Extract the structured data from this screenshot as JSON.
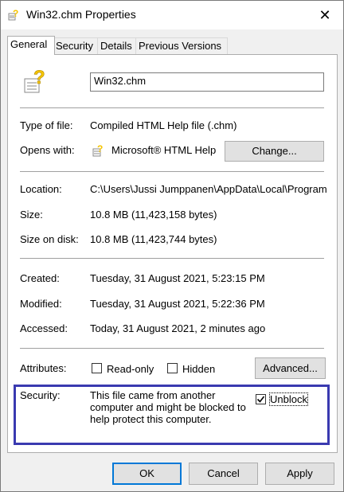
{
  "window": {
    "title": "Win32.chm Properties",
    "close_glyph": "✕",
    "help_icon": "help-file-icon"
  },
  "tabs": [
    {
      "label": "General",
      "active": true
    },
    {
      "label": "Security",
      "active": false
    },
    {
      "label": "Details",
      "active": false
    },
    {
      "label": "Previous Versions",
      "active": false
    }
  ],
  "general": {
    "file_name": "Win32.chm",
    "type_label": "Type of file:",
    "type_value": "Compiled HTML Help file (.chm)",
    "opens_label": "Opens with:",
    "opens_value": "Microsoft® HTML Help Executable",
    "change_button": "Change...",
    "location_label": "Location:",
    "location_value": "C:\\Users\\Jussi Jumppanen\\AppData\\Local\\Programs",
    "size_label": "Size:",
    "size_value": "10.8 MB (11,423,158 bytes)",
    "size_on_disk_label": "Size on disk:",
    "size_on_disk_value": "10.8 MB (11,423,744 bytes)",
    "created_label": "Created:",
    "created_value": "Tuesday, 31 August 2021, 5:23:15 PM",
    "modified_label": "Modified:",
    "modified_value": "Tuesday, 31 August 2021, 5:22:36 PM",
    "accessed_label": "Accessed:",
    "accessed_value": "Today, 31 August 2021, 2 minutes ago",
    "attributes_label": "Attributes:",
    "readonly_label": "Read-only",
    "readonly_checked": false,
    "hidden_label": "Hidden",
    "hidden_checked": false,
    "advanced_button": "Advanced...",
    "security_label": "Security:",
    "security_text": "This file came from another computer and might be blocked to help protect this computer.",
    "unblock_label": "Unblock",
    "unblock_checked": true
  },
  "footer": {
    "ok": "OK",
    "cancel": "Cancel",
    "apply": "Apply"
  },
  "colors": {
    "highlight_border": "#3a3ab0",
    "help_icon_yellow": "#f5c400"
  }
}
